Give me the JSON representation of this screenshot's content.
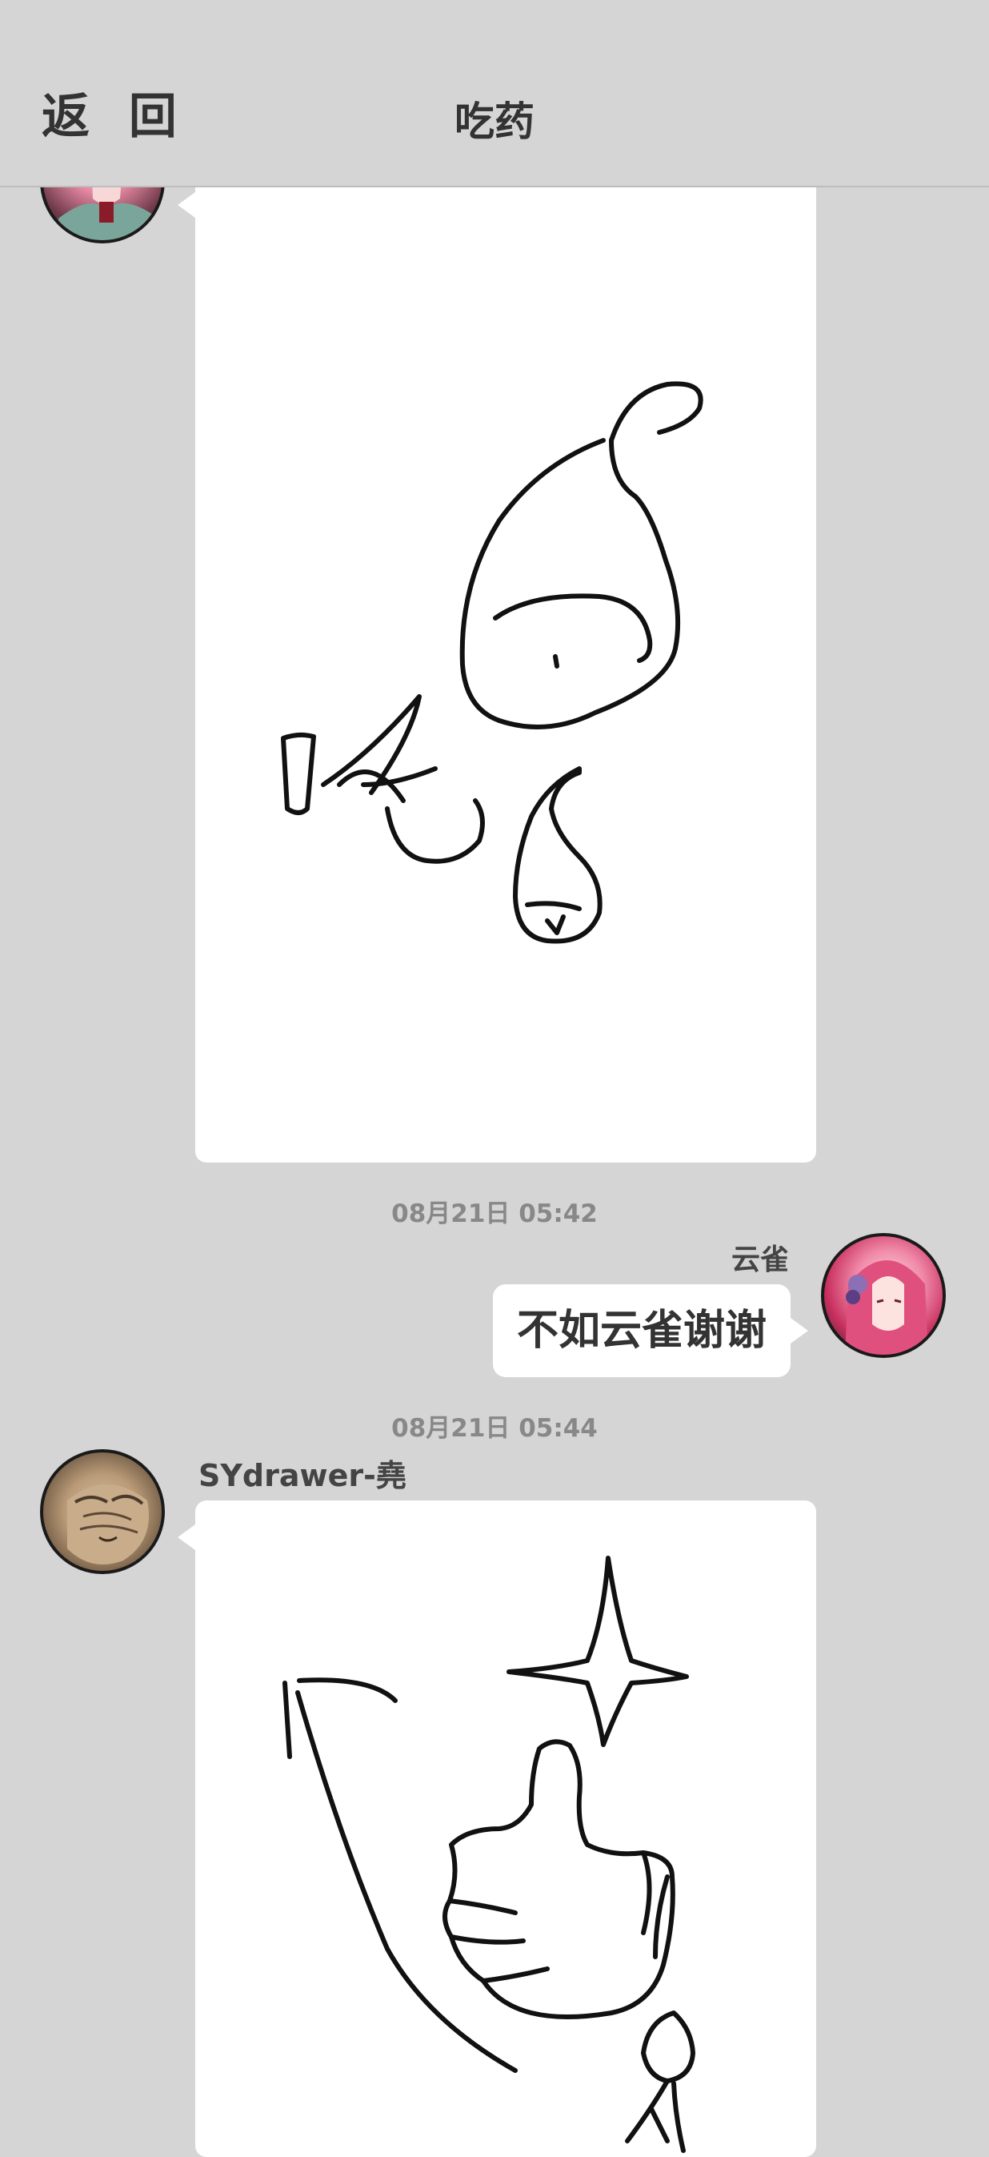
{
  "header": {
    "back_label": "返 回",
    "title": "吃药"
  },
  "messages": [
    {
      "type": "drawing",
      "side": "left",
      "drawing_description_icon": "handwritten-drawing",
      "drawn_text": "吃8"
    },
    {
      "type": "timestamp",
      "text": "08月21日  05:42"
    },
    {
      "type": "text",
      "side": "right",
      "sender": "云雀",
      "text": "不如云雀谢谢"
    },
    {
      "type": "timestamp",
      "text": "08月21日  05:44"
    },
    {
      "type": "drawing",
      "side": "left",
      "sender": "SYdrawer-堯",
      "drawing_description_icon": "thumbs-up-sparkle-drawing"
    }
  ],
  "colors": {
    "background": "#d5d5d5",
    "bubble": "#ffffff",
    "text": "#333333",
    "timestamp": "#888888"
  }
}
